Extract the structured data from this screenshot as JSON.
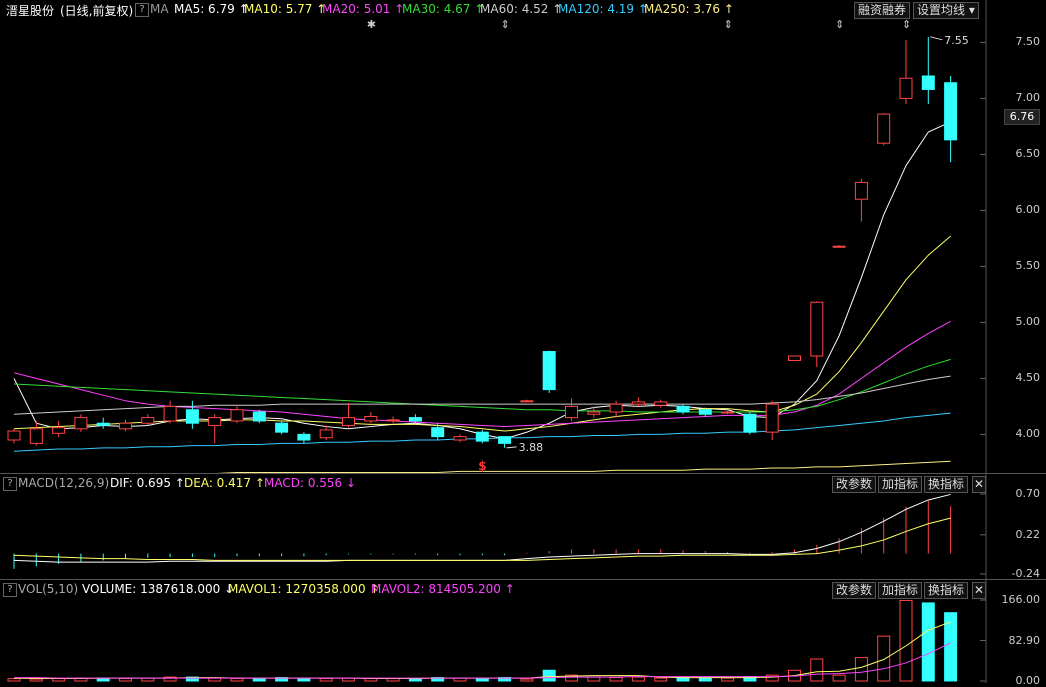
{
  "main": {
    "stock_name": "溍星股份",
    "period_label": "(日线,前复权)",
    "help_glyph": "?",
    "ma_toggle": "MA",
    "ma_items": [
      {
        "label": "MA5: 6.79",
        "arrow": "↑",
        "color": "#ffffff"
      },
      {
        "label": "MA10: 5.77",
        "arrow": "↑",
        "color": "#ffff66"
      },
      {
        "label": "MA20: 5.01",
        "arrow": "↑",
        "color": "#ff44ff"
      },
      {
        "label": "MA30: 4.67",
        "arrow": "↑",
        "color": "#33dd33"
      },
      {
        "label": "MA60: 4.52",
        "arrow": "↑",
        "color": "#cccccc"
      },
      {
        "label": "MA120: 4.19",
        "arrow": "↑",
        "color": "#33ccff"
      },
      {
        "label": "MA250: 3.76",
        "arrow": "↑",
        "color": "#ffee88"
      }
    ],
    "buttons": {
      "margin": "融资融券",
      "settings": "设置均线 ▾"
    },
    "y_ticks": [
      "7.50",
      "7.00",
      "6.50",
      "6.00",
      "5.50",
      "5.00",
      "4.50",
      "4.00"
    ],
    "current_price": "6.76",
    "high_label": "7.55",
    "low_label": "3.88",
    "event_marker": "$",
    "top_markers": [
      "✱",
      "⇕",
      "⇕",
      "⇕",
      "⇕"
    ]
  },
  "macd": {
    "title": "MACD(12,26,9)",
    "dif_label": "DIF: 0.695",
    "dif_arrow": "↑",
    "dea_label": "DEA: 0.417",
    "dea_arrow": "↑",
    "macd_label": "MACD: 0.556",
    "macd_arrow": "↓",
    "buttons": {
      "params": "改参数",
      "add": "加指标",
      "switch": "换指标",
      "close": "✕"
    },
    "y_ticks": [
      "0.70",
      "0.22",
      "-0.24"
    ]
  },
  "vol": {
    "title": "VOL(5,10)",
    "volume_label": "VOLUME: 1387618.000",
    "volume_arrow": "↓",
    "mavol1_label": "MAVOL1: 1270358.000",
    "mavol1_arrow": "↑",
    "mavol2_label": "MAVOL2: 814505.200",
    "mavol2_arrow": "↑",
    "buttons": {
      "params": "改参数",
      "add": "加指标",
      "switch": "换指标",
      "close": "✕"
    },
    "y_ticks": [
      "166.00",
      "82.90",
      "0.00"
    ]
  },
  "chart_data": {
    "type": "candlestick",
    "ylim": [
      3.7,
      7.7
    ],
    "candles": [
      {
        "o": 3.95,
        "c": 4.03,
        "h": 4.05,
        "l": 3.92
      },
      {
        "o": 3.92,
        "c": 4.05,
        "h": 4.12,
        "l": 3.9
      },
      {
        "o": 4.01,
        "c": 4.06,
        "h": 4.12,
        "l": 3.98
      },
      {
        "o": 4.05,
        "c": 4.15,
        "h": 4.18,
        "l": 4.02
      },
      {
        "o": 4.1,
        "c": 4.08,
        "h": 4.15,
        "l": 4.05
      },
      {
        "o": 4.05,
        "c": 4.1,
        "h": 4.13,
        "l": 4.03
      },
      {
        "o": 4.1,
        "c": 4.15,
        "h": 4.18,
        "l": 4.08
      },
      {
        "o": 4.12,
        "c": 4.25,
        "h": 4.3,
        "l": 4.1
      },
      {
        "o": 4.22,
        "c": 4.1,
        "h": 4.3,
        "l": 4.05
      },
      {
        "o": 4.08,
        "c": 4.15,
        "h": 4.18,
        "l": 3.92
      },
      {
        "o": 4.12,
        "c": 4.22,
        "h": 4.25,
        "l": 4.1
      },
      {
        "o": 4.2,
        "c": 4.12,
        "h": 4.22,
        "l": 4.1
      },
      {
        "o": 4.1,
        "c": 4.02,
        "h": 4.12,
        "l": 4.0
      },
      {
        "o": 4.0,
        "c": 3.95,
        "h": 4.02,
        "l": 3.92
      },
      {
        "o": 3.97,
        "c": 4.04,
        "h": 4.08,
        "l": 3.95
      },
      {
        "o": 4.08,
        "c": 4.15,
        "h": 4.28,
        "l": 4.06
      },
      {
        "o": 4.12,
        "c": 4.16,
        "h": 4.2,
        "l": 4.1
      },
      {
        "o": 4.13,
        "c": 4.13,
        "h": 4.16,
        "l": 4.1
      },
      {
        "o": 4.15,
        "c": 4.12,
        "h": 4.18,
        "l": 4.1
      },
      {
        "o": 4.06,
        "c": 3.98,
        "h": 4.1,
        "l": 3.95
      },
      {
        "o": 3.95,
        "c": 3.98,
        "h": 4.0,
        "l": 3.93
      },
      {
        "o": 4.02,
        "c": 3.94,
        "h": 4.04,
        "l": 3.92
      },
      {
        "o": 3.98,
        "c": 3.92,
        "h": 3.98,
        "l": 3.88
      },
      {
        "o": 4.3,
        "c": 4.3,
        "h": 4.31,
        "l": 4.29
      },
      {
        "o": 4.74,
        "c": 4.4,
        "h": 4.75,
        "l": 4.37
      },
      {
        "o": 4.15,
        "c": 4.25,
        "h": 4.32,
        "l": 4.12
      },
      {
        "o": 4.18,
        "c": 4.2,
        "h": 4.25,
        "l": 4.15
      },
      {
        "o": 4.2,
        "c": 4.27,
        "h": 4.3,
        "l": 4.15
      },
      {
        "o": 4.27,
        "c": 4.29,
        "h": 4.33,
        "l": 4.25
      },
      {
        "o": 4.26,
        "c": 4.29,
        "h": 4.31,
        "l": 4.24
      },
      {
        "o": 4.25,
        "c": 4.2,
        "h": 4.27,
        "l": 4.18
      },
      {
        "o": 4.22,
        "c": 4.18,
        "h": 4.24,
        "l": 4.16
      },
      {
        "o": 4.2,
        "c": 4.2,
        "h": 4.22,
        "l": 4.18
      },
      {
        "o": 4.18,
        "c": 4.02,
        "h": 4.2,
        "l": 4.0
      },
      {
        "o": 4.02,
        "c": 4.27,
        "h": 4.3,
        "l": 3.95
      },
      {
        "o": 4.66,
        "c": 4.7,
        "h": 4.7,
        "l": 4.66
      },
      {
        "o": 4.7,
        "c": 5.18,
        "h": 5.19,
        "l": 4.6
      },
      {
        "o": 5.68,
        "c": 5.68,
        "h": 5.69,
        "l": 5.67
      },
      {
        "o": 6.1,
        "c": 6.25,
        "h": 6.28,
        "l": 5.9
      },
      {
        "o": 6.6,
        "c": 6.86,
        "h": 6.87,
        "l": 6.58
      },
      {
        "o": 7.0,
        "c": 7.18,
        "h": 7.52,
        "l": 6.95
      },
      {
        "o": 7.2,
        "c": 7.08,
        "h": 7.55,
        "l": 6.95
      },
      {
        "o": 7.14,
        "c": 6.63,
        "h": 7.2,
        "l": 6.43
      }
    ],
    "ma_series": [
      {
        "name": "MA5",
        "color": "#ffffff",
        "values": [
          4.5,
          4.1,
          4.05,
          4.06,
          4.08,
          4.07,
          4.08,
          4.12,
          4.14,
          4.13,
          4.14,
          4.15,
          4.14,
          4.1,
          4.07,
          4.05,
          4.07,
          4.09,
          4.1,
          4.08,
          4.05,
          4.0,
          3.96,
          4.02,
          4.1,
          4.2,
          4.24,
          4.26,
          4.25,
          4.26,
          4.25,
          4.23,
          4.22,
          4.16,
          4.15,
          4.27,
          4.48,
          4.88,
          5.4,
          5.96,
          6.4,
          6.7,
          6.79
        ]
      },
      {
        "name": "MA10",
        "color": "#ffff66",
        "values": [
          4.05,
          4.06,
          4.07,
          4.08,
          4.09,
          4.1,
          4.11,
          4.12,
          4.12,
          4.12,
          4.13,
          4.13,
          4.12,
          4.12,
          4.11,
          4.1,
          4.09,
          4.09,
          4.09,
          4.08,
          4.07,
          4.05,
          4.03,
          4.05,
          4.07,
          4.1,
          4.13,
          4.16,
          4.18,
          4.2,
          4.22,
          4.23,
          4.23,
          4.21,
          4.2,
          4.26,
          4.36,
          4.56,
          4.82,
          5.1,
          5.38,
          5.6,
          5.77
        ]
      },
      {
        "name": "MA20",
        "color": "#ff44ff",
        "values": [
          4.55,
          4.5,
          4.45,
          4.4,
          4.35,
          4.3,
          4.27,
          4.25,
          4.24,
          4.23,
          4.22,
          4.21,
          4.2,
          4.18,
          4.16,
          4.14,
          4.13,
          4.12,
          4.11,
          4.1,
          4.09,
          4.08,
          4.07,
          4.08,
          4.09,
          4.1,
          4.11,
          4.12,
          4.13,
          4.14,
          4.15,
          4.16,
          4.17,
          4.17,
          4.17,
          4.2,
          4.26,
          4.36,
          4.5,
          4.64,
          4.78,
          4.9,
          5.01
        ]
      },
      {
        "name": "MA30",
        "color": "#33dd33",
        "values": [
          4.45,
          4.44,
          4.43,
          4.42,
          4.41,
          4.4,
          4.39,
          4.38,
          4.37,
          4.36,
          4.35,
          4.34,
          4.33,
          4.32,
          4.31,
          4.3,
          4.29,
          4.28,
          4.27,
          4.26,
          4.25,
          4.24,
          4.23,
          4.22,
          4.22,
          4.21,
          4.21,
          4.21,
          4.2,
          4.2,
          4.2,
          4.2,
          4.2,
          4.2,
          4.2,
          4.22,
          4.25,
          4.31,
          4.38,
          4.46,
          4.54,
          4.61,
          4.67
        ]
      },
      {
        "name": "MA60",
        "color": "#cccccc",
        "values": [
          4.18,
          4.19,
          4.2,
          4.21,
          4.22,
          4.23,
          4.24,
          4.25,
          4.25,
          4.26,
          4.26,
          4.26,
          4.27,
          4.27,
          4.27,
          4.27,
          4.27,
          4.27,
          4.27,
          4.27,
          4.27,
          4.27,
          4.27,
          4.27,
          4.27,
          4.27,
          4.27,
          4.27,
          4.27,
          4.27,
          4.27,
          4.27,
          4.27,
          4.27,
          4.28,
          4.29,
          4.31,
          4.34,
          4.37,
          4.41,
          4.45,
          4.49,
          4.52
        ]
      },
      {
        "name": "MA120",
        "color": "#33ccff",
        "values": [
          3.85,
          3.86,
          3.87,
          3.87,
          3.88,
          3.88,
          3.89,
          3.89,
          3.9,
          3.9,
          3.91,
          3.91,
          3.92,
          3.92,
          3.93,
          3.93,
          3.94,
          3.94,
          3.95,
          3.95,
          3.96,
          3.96,
          3.97,
          3.97,
          3.98,
          3.98,
          3.99,
          3.99,
          4.0,
          4.0,
          4.01,
          4.01,
          4.02,
          4.02,
          4.03,
          4.04,
          4.06,
          4.08,
          4.1,
          4.12,
          4.15,
          4.17,
          4.19
        ]
      },
      {
        "name": "MA250",
        "color": "#ffee88",
        "values": [
          3.65,
          3.65,
          3.65,
          3.65,
          3.65,
          3.65,
          3.65,
          3.65,
          3.65,
          3.65,
          3.66,
          3.66,
          3.66,
          3.66,
          3.66,
          3.66,
          3.66,
          3.66,
          3.66,
          3.66,
          3.67,
          3.67,
          3.67,
          3.67,
          3.67,
          3.67,
          3.67,
          3.68,
          3.68,
          3.68,
          3.68,
          3.69,
          3.69,
          3.69,
          3.7,
          3.7,
          3.71,
          3.71,
          3.72,
          3.73,
          3.74,
          3.75,
          3.76
        ]
      }
    ],
    "macd_ylim": [
      -0.24,
      0.7
    ],
    "macd_hist": [
      -0.18,
      -0.15,
      -0.12,
      -0.1,
      -0.08,
      -0.06,
      -0.05,
      -0.04,
      -0.04,
      -0.04,
      -0.03,
      -0.03,
      -0.03,
      -0.03,
      -0.02,
      -0.01,
      -0.01,
      -0.01,
      -0.01,
      -0.02,
      -0.02,
      -0.02,
      -0.02,
      0.01,
      0.03,
      0.05,
      0.05,
      0.05,
      0.05,
      0.05,
      0.04,
      0.03,
      0.02,
      0.01,
      0.02,
      0.05,
      0.1,
      0.18,
      0.3,
      0.42,
      0.55,
      0.62,
      0.556
    ],
    "macd_dif": [
      -0.08,
      -0.09,
      -0.1,
      -0.1,
      -0.1,
      -0.1,
      -0.1,
      -0.09,
      -0.09,
      -0.09,
      -0.09,
      -0.09,
      -0.09,
      -0.09,
      -0.09,
      -0.08,
      -0.08,
      -0.08,
      -0.08,
      -0.08,
      -0.08,
      -0.08,
      -0.08,
      -0.06,
      -0.04,
      -0.03,
      -0.02,
      -0.01,
      0.0,
      0.0,
      0.0,
      0.0,
      0.0,
      -0.01,
      -0.01,
      0.01,
      0.06,
      0.14,
      0.25,
      0.38,
      0.52,
      0.63,
      0.695
    ],
    "macd_dea": [
      -0.02,
      -0.03,
      -0.04,
      -0.05,
      -0.06,
      -0.06,
      -0.07,
      -0.07,
      -0.07,
      -0.08,
      -0.08,
      -0.08,
      -0.08,
      -0.08,
      -0.08,
      -0.08,
      -0.08,
      -0.08,
      -0.08,
      -0.08,
      -0.08,
      -0.08,
      -0.08,
      -0.08,
      -0.07,
      -0.06,
      -0.05,
      -0.04,
      -0.03,
      -0.03,
      -0.02,
      -0.02,
      -0.02,
      -0.02,
      -0.02,
      -0.01,
      0.0,
      0.04,
      0.09,
      0.16,
      0.26,
      0.35,
      0.417
    ],
    "vol_ylim": [
      0,
      166
    ],
    "volume": [
      5,
      4,
      5,
      6,
      6,
      5,
      6,
      8,
      8,
      6,
      5,
      6,
      7,
      5,
      5,
      6,
      5,
      5,
      5,
      7,
      6,
      6,
      7,
      4,
      22,
      12,
      8,
      7,
      8,
      6,
      7,
      6,
      6,
      9,
      12,
      22,
      45,
      12,
      48,
      92,
      165,
      160,
      140
    ],
    "mavol1": [
      6,
      5,
      5,
      5,
      6,
      6,
      6,
      6,
      7,
      7,
      6,
      6,
      6,
      6,
      6,
      6,
      5,
      5,
      5,
      6,
      6,
      6,
      6,
      6,
      9,
      10,
      11,
      11,
      11,
      8,
      7,
      7,
      7,
      7,
      8,
      11,
      19,
      20,
      28,
      44,
      72,
      104,
      121
    ],
    "mavol2": [
      7,
      7,
      6,
      6,
      6,
      6,
      6,
      6,
      6,
      6,
      6,
      6,
      6,
      6,
      6,
      6,
      6,
      6,
      6,
      6,
      6,
      6,
      6,
      6,
      7,
      8,
      8,
      8,
      9,
      9,
      9,
      9,
      9,
      9,
      9,
      10,
      14,
      15,
      18,
      25,
      37,
      56,
      78
    ]
  }
}
